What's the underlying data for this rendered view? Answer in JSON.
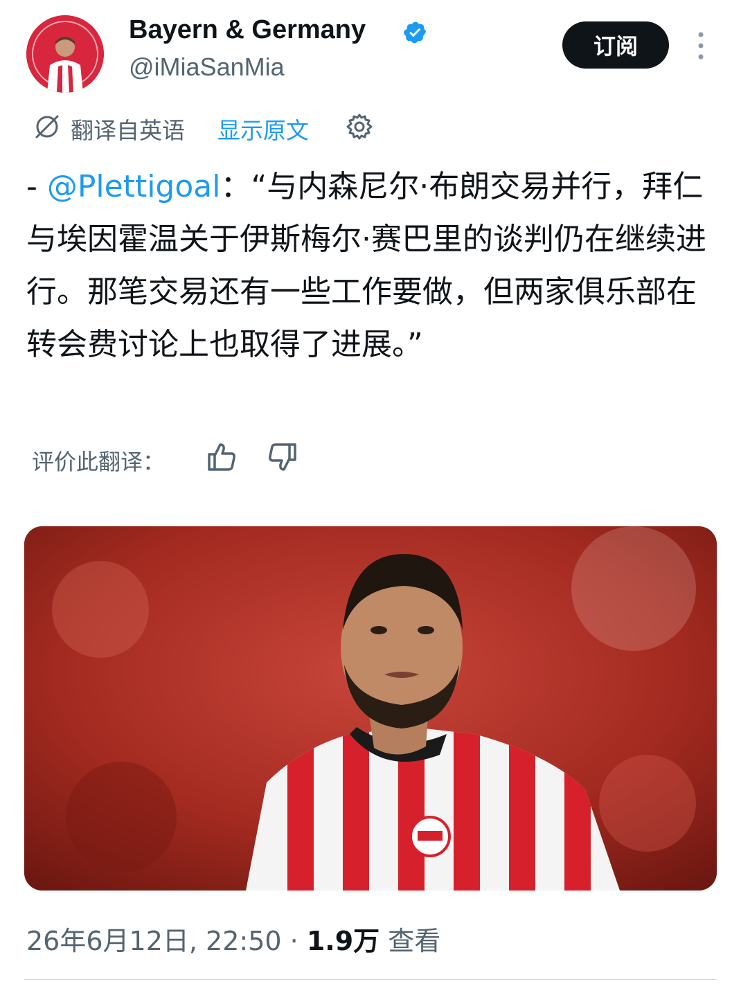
{
  "profile": {
    "display_name": "Bayern & Germany",
    "handle": "@iMiaSanMia",
    "subscribe_label": "订阅"
  },
  "translation": {
    "translated_from": "翻译自英语",
    "show_original": "显示原文"
  },
  "tweet": {
    "prefix": "- ",
    "mention": "@Plettigoal",
    "body": "：“与内森尼尔·布朗交易并行，拜仁与埃因霍温关于伊斯梅尔·赛巴里的谈判仍在继续进行。那笔交易还有一些工作要做，但两家俱乐部在转会费讨论上也取得了进展。”"
  },
  "rating": {
    "label": "评价此翻译："
  },
  "meta": {
    "timestamp": "26年6月12日, 22:50",
    "separator": " · ",
    "views_count": "1.9万",
    "views_label": " 查看"
  },
  "colors": {
    "accent": "#1d9bf0",
    "text_primary": "#0f1419",
    "text_secondary": "#536471",
    "button_bg": "#0f1419"
  },
  "icons": [
    "avatar",
    "verified-badge-icon",
    "more-vertical-icon",
    "translate-off-icon",
    "gear-icon",
    "thumb-up-icon",
    "thumb-down-icon"
  ]
}
